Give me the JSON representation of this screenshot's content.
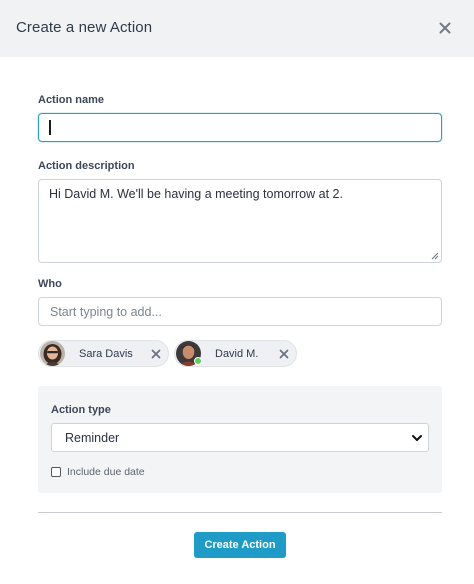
{
  "dialog": {
    "title": "Create a new Action"
  },
  "form": {
    "action_name": {
      "label": "Action name",
      "value": ""
    },
    "action_description": {
      "label": "Action description",
      "value": "Hi David M. We'll be having a meeting tomorrow at 2."
    },
    "who": {
      "label": "Who",
      "placeholder": "Start typing to add...",
      "people": [
        {
          "name": "Sara Davis",
          "online": false
        },
        {
          "name": "David M.",
          "online": true
        }
      ]
    },
    "action_type": {
      "label": "Action type",
      "selected": "Reminder",
      "include_due_date": {
        "label": "Include due date",
        "checked": false
      }
    },
    "submit_label": "Create Action"
  },
  "colors": {
    "accent": "#1e9cc7",
    "focus_border": "#22a2c2",
    "online": "#5bd15b",
    "header_bg": "#f1f2f4"
  },
  "icons": {
    "close": "close-icon",
    "chip_remove": "close-icon",
    "select": "chevron-down-icon"
  }
}
